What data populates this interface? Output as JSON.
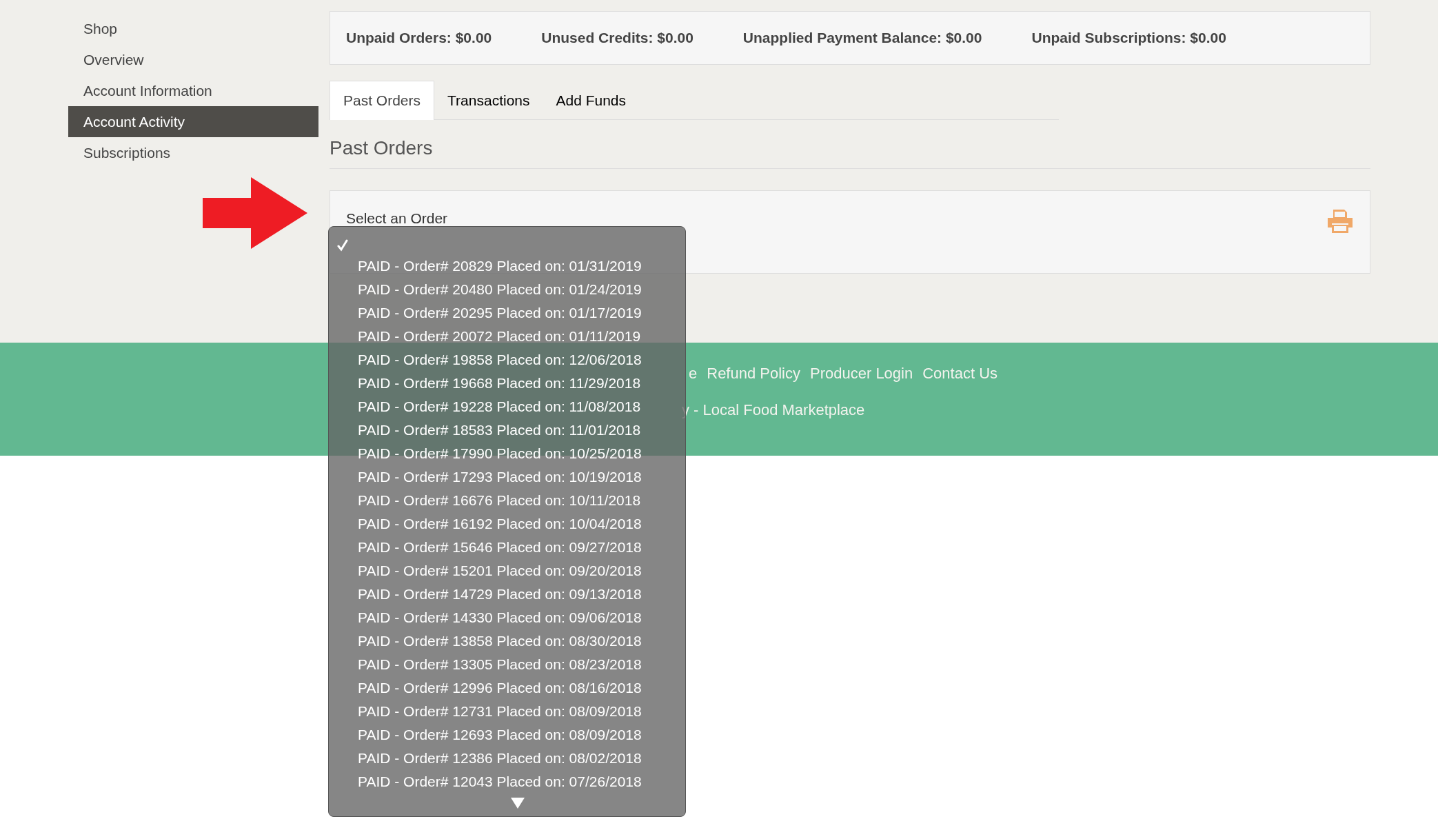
{
  "sidebar": {
    "items": [
      {
        "label": "Shop",
        "selected": false
      },
      {
        "label": "Overview",
        "selected": false
      },
      {
        "label": "Account Information",
        "selected": false
      },
      {
        "label": "Account Activity",
        "selected": true
      },
      {
        "label": "Subscriptions",
        "selected": false
      }
    ]
  },
  "summary": [
    "Unpaid Orders: $0.00",
    "Unused Credits: $0.00",
    "Unapplied Payment Balance: $0.00",
    "Unpaid Subscriptions: $0.00"
  ],
  "tabs": [
    {
      "label": "Past Orders",
      "selected": true
    },
    {
      "label": "Transactions",
      "selected": false
    },
    {
      "label": "Add Funds",
      "selected": false
    }
  ],
  "section_title": "Past Orders",
  "order_select": {
    "label": "Select an Order"
  },
  "footer": {
    "links": [
      "e",
      "Refund Policy",
      "Producer Login",
      "Contact Us"
    ],
    "copyright": "y - Local Food Marketplace"
  },
  "dropdown": {
    "blank_option": {
      "selected": true
    },
    "options": [
      {
        "label": "PAID - Order# 20829 Placed on: 01/31/2019",
        "selected": false
      },
      {
        "label": "PAID - Order# 20480 Placed on: 01/24/2019",
        "selected": false
      },
      {
        "label": "PAID - Order# 20295 Placed on: 01/17/2019",
        "selected": false
      },
      {
        "label": "PAID - Order# 20072 Placed on: 01/11/2019",
        "selected": false
      },
      {
        "label": "PAID - Order# 19858 Placed on: 12/06/2018",
        "selected": false
      },
      {
        "label": "PAID - Order# 19668 Placed on: 11/29/2018",
        "selected": false
      },
      {
        "label": "PAID - Order# 19228 Placed on: 11/08/2018",
        "selected": false
      },
      {
        "label": "PAID - Order# 18583 Placed on: 11/01/2018",
        "selected": false
      },
      {
        "label": "PAID - Order# 17990 Placed on: 10/25/2018",
        "selected": false
      },
      {
        "label": "PAID - Order# 17293 Placed on: 10/19/2018",
        "selected": false
      },
      {
        "label": "PAID - Order# 16676 Placed on: 10/11/2018",
        "selected": false
      },
      {
        "label": "PAID - Order# 16192 Placed on: 10/04/2018",
        "selected": false
      },
      {
        "label": "PAID - Order# 15646 Placed on: 09/27/2018",
        "selected": false
      },
      {
        "label": "PAID - Order# 15201 Placed on: 09/20/2018",
        "selected": false
      },
      {
        "label": "PAID - Order# 14729 Placed on: 09/13/2018",
        "selected": false
      },
      {
        "label": "PAID - Order# 14330 Placed on: 09/06/2018",
        "selected": false
      },
      {
        "label": "PAID - Order# 13858 Placed on: 08/30/2018",
        "selected": false
      },
      {
        "label": "PAID - Order# 13305 Placed on: 08/23/2018",
        "selected": false
      },
      {
        "label": "PAID - Order# 12996 Placed on: 08/16/2018",
        "selected": false
      },
      {
        "label": "PAID - Order# 12731 Placed on: 08/09/2018",
        "selected": false
      },
      {
        "label": "PAID - Order# 12693 Placed on: 08/09/2018",
        "selected": false
      },
      {
        "label": "PAID - Order# 12386 Placed on: 08/02/2018",
        "selected": false
      },
      {
        "label": "PAID - Order# 12043 Placed on: 07/26/2018",
        "selected": false
      }
    ]
  }
}
